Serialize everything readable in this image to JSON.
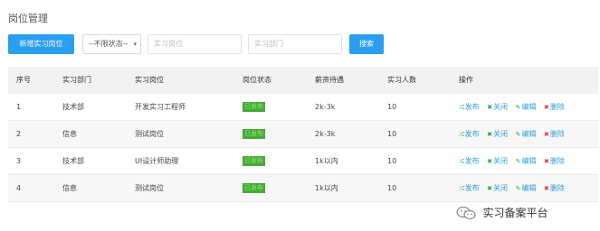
{
  "page": {
    "title": "岗位管理"
  },
  "toolbar": {
    "new_button": "新增实习岗位",
    "status_select": "--不限状态--",
    "post_placeholder": "实习岗位",
    "dept_placeholder": "实习部门",
    "search_button": "搜索"
  },
  "table": {
    "headers": [
      "序号",
      "实习部门",
      "实习岗位",
      "岗位状态",
      "薪资待遇",
      "实习人数",
      "操作"
    ],
    "rows": [
      {
        "index": "1",
        "dept": "技术部",
        "post": "开发实习工程师",
        "status": "已发布",
        "salary": "2k-3k",
        "count": "10"
      },
      {
        "index": "2",
        "dept": "信息",
        "post": "测试岗位",
        "status": "已发布",
        "salary": "2k-3k",
        "count": "10"
      },
      {
        "index": "3",
        "dept": "技术部",
        "post": "UI设计师助理",
        "status": "已发布",
        "salary": "1k以内",
        "count": "10"
      },
      {
        "index": "4",
        "dept": "信息",
        "post": "测试岗位",
        "status": "已发布",
        "salary": "1k以内",
        "count": "10"
      }
    ],
    "actions": {
      "publish": "发布",
      "close": "关闭",
      "edit": "编辑",
      "delete": "删除"
    }
  },
  "watermark": {
    "text": "实习备案平台"
  },
  "colors": {
    "primary": "#2a9ef0",
    "status_bg": "#4aa83a",
    "status_text": "#7ef562",
    "action_text": "#2e9fdc",
    "delete_icon": "#e53935"
  }
}
